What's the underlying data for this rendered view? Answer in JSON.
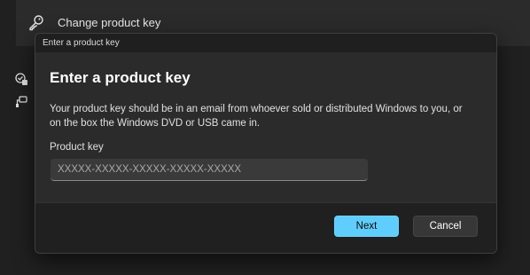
{
  "background": {
    "row_label": "Change product key"
  },
  "dialog": {
    "window_title": "Enter a product key",
    "heading": "Enter a product key",
    "description": "Your product key should be in an email from whoever sold or distributed Windows to you, or on the box the Windows DVD or USB came in.",
    "field_label": "Product key",
    "input_placeholder": "XXXXX-XXXXX-XXXXX-XXXXX-XXXXX",
    "input_value": "",
    "next_label": "Next",
    "cancel_label": "Cancel"
  },
  "colors": {
    "accent": "#60cdff",
    "dialog_bg": "#2b2b2b",
    "footer_bg": "#202020"
  },
  "icons": [
    "key-icon",
    "security-badge-icon",
    "activation-icon"
  ]
}
